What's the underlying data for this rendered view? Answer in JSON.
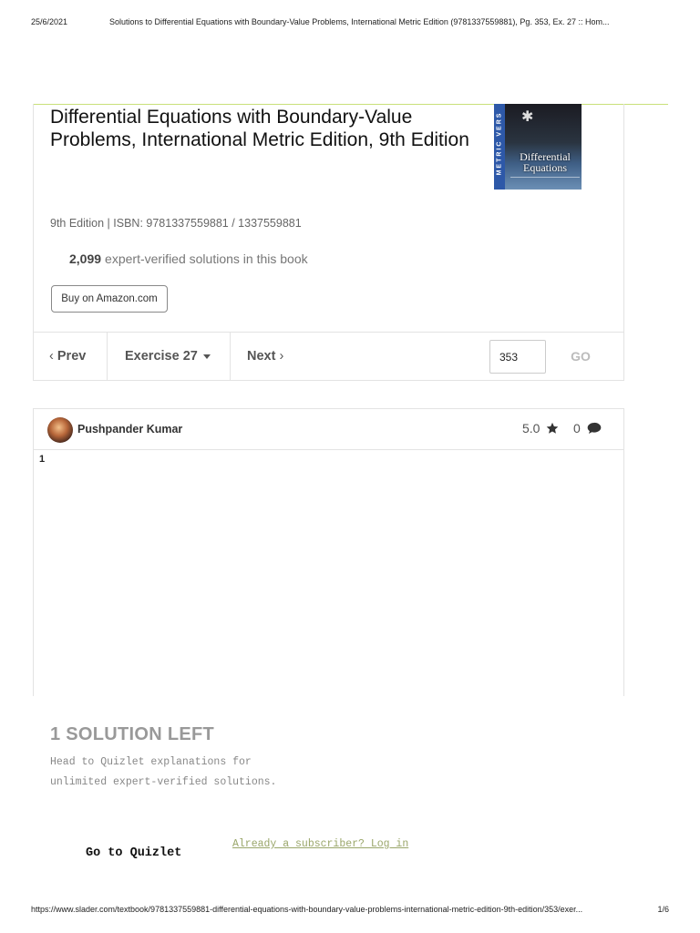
{
  "print_header": {
    "date": "25/6/2021",
    "title": "Solutions to Differential Equations with Boundary-Value Problems, International Metric Edition (9781337559881), Pg. 353, Ex. 27 :: Hom..."
  },
  "book": {
    "title": "Differential Equations with Boundary-Value Problems, International Metric Edition, 9th Edition",
    "cover": {
      "spine_text": "METRIC VERS",
      "title": "Differential Equations"
    },
    "isbn_line": "9th Edition | ISBN: 9781337559881 / 1337559881",
    "solutions_count": "2,099",
    "solutions_text": "expert-verified solutions in this book",
    "buy_label": "Buy on Amazon.com"
  },
  "nav": {
    "prev_label": "Prev",
    "exercise_label": "Exercise 27",
    "next_label": "Next",
    "page_value": "353",
    "go_label": "GO"
  },
  "solution": {
    "author": "Pushpander Kumar",
    "rating": "5.0",
    "comments": "0",
    "step": "1"
  },
  "paywall": {
    "heading": "1 SOLUTION LEFT",
    "line1": "Head to Quizlet explanations for",
    "line2": "unlimited expert-verified solutions.",
    "quizlet_label": "Go to Quizlet",
    "login_label": "Already a subscriber? Log in"
  },
  "print_footer": {
    "url": "https://www.slader.com/textbook/9781337559881-differential-equations-with-boundary-value-problems-international-metric-edition-9th-edition/353/exer...",
    "page": "1/6"
  }
}
